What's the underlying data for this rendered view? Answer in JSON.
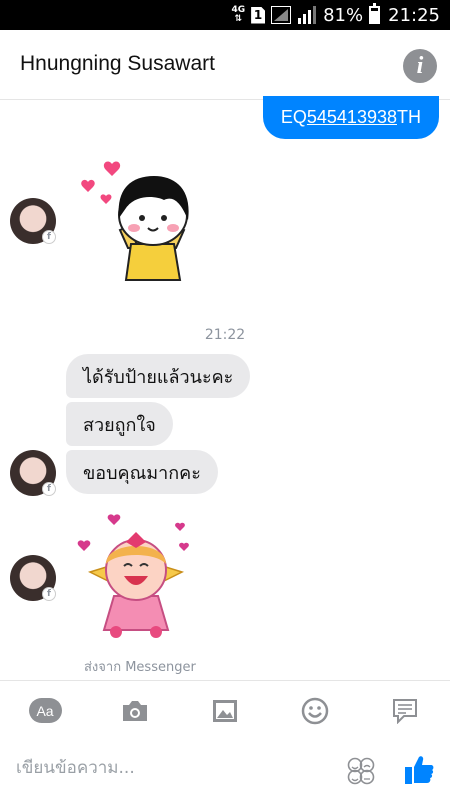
{
  "status_bar": {
    "network": "4G",
    "sim": "1",
    "battery_percent": "81%",
    "time": "21:25"
  },
  "header": {
    "title": "Hnungning Susawart",
    "info_icon": "info-icon"
  },
  "messages": {
    "sent_tracking_prefix": "EQ",
    "sent_tracking_link": "545413938",
    "sent_tracking_suffix": "TH",
    "timestamp": "21:22",
    "received": [
      "ได้รับป้ายแล้วนะคะ",
      "สวยถูกใจ",
      "ขอบคุณมากคะ"
    ],
    "sent_from": "ส่งจาก Messenger"
  },
  "composer": {
    "aa_label": "Aa",
    "placeholder": "เขียนข้อความ...",
    "tools": [
      "text-icon",
      "camera-icon",
      "gallery-icon",
      "emoji-icon",
      "quick-reply-icon"
    ]
  },
  "colors": {
    "sent_bubble": "#0084ff",
    "received_bubble": "#e9e9eb",
    "icon_gray": "#8e9094",
    "like_blue": "#0084ff"
  }
}
